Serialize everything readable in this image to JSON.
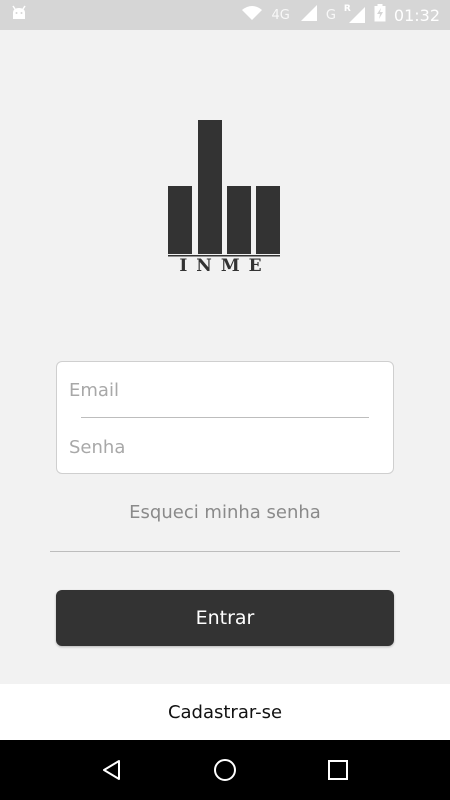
{
  "status_bar": {
    "time": "01:32",
    "network_labels": [
      "4G",
      "G",
      "R"
    ],
    "icons": [
      "android-icon",
      "wifi-icon",
      "signal-icon",
      "signal-icon",
      "battery-charging-icon"
    ]
  },
  "logo": {
    "text": "INME",
    "icon": "inme-building-logo"
  },
  "login_form": {
    "email_placeholder": "Email",
    "password_placeholder": "Senha"
  },
  "forgot_password_label": "Esqueci minha senha",
  "enter_button_label": "Entrar",
  "register_label": "Cadastrar-se",
  "nav_bar": {
    "icons": [
      "back-icon",
      "home-icon",
      "recents-icon"
    ]
  },
  "colors": {
    "background": "#f2f2f2",
    "primary_button": "#333333",
    "status_bar": "#d6d6d6",
    "nav_bar": "#000000",
    "muted_text": "#8a8a8a"
  }
}
